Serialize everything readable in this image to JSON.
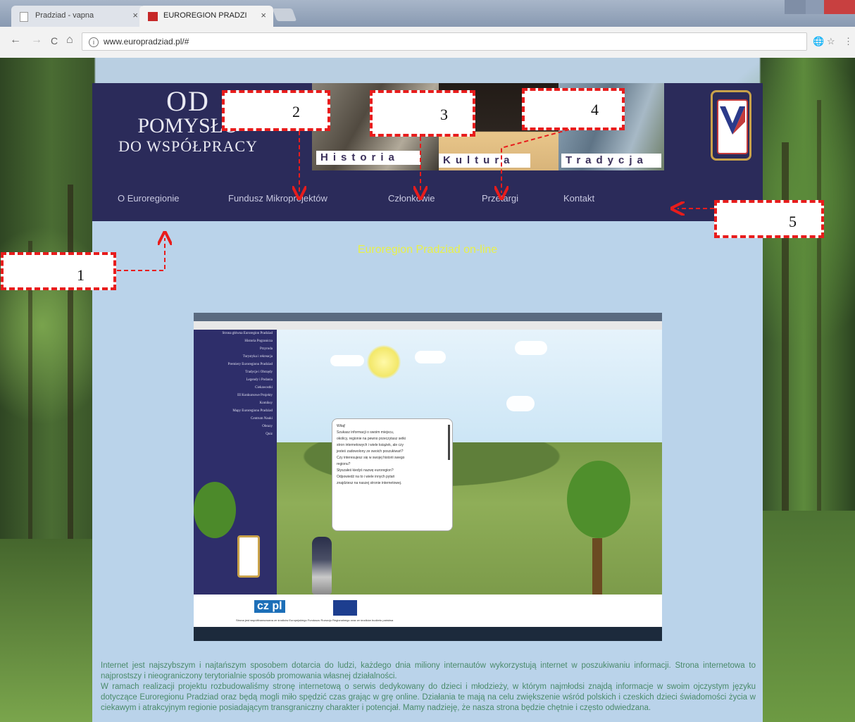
{
  "browser": {
    "tabs": [
      {
        "title": "Pradziad - vapna",
        "close": "×"
      },
      {
        "title": "EUROREGION PRADZI",
        "close": "×"
      }
    ],
    "url": "www.europradziad.pl/#",
    "info_icon": "i",
    "back_icon": "←",
    "forward_icon": "→",
    "reload_icon": "C",
    "home_icon": "⌂",
    "translate_icon": "🌐",
    "star_icon": "☆",
    "menu_icon": "⋮",
    "accent": "#e81c1c"
  },
  "site": {
    "logo": {
      "line1": "OD",
      "line2": "POMYSŁU",
      "line3": "DO WSPÓŁPRACY"
    },
    "banners": [
      "Historia",
      "Kultura",
      "Tradycja"
    ],
    "nav": [
      "O Euroregionie",
      "Fundusz Mikroprojektów",
      "Członkowie",
      "Przetargi",
      "Kontakt"
    ],
    "subtitle": "Euroregion Pradziad on-line",
    "screenshot": {
      "sidebar_items": [
        "Strona główna Euroregion Pradziad",
        "Historia Pogranicza",
        "Przyroda",
        "Turystyka i rekreacja",
        "Premiery Euroregionu Pradziad",
        "Tradycje i Obrzędy",
        "Legendy i Podania",
        "Ciekawostki",
        "III Konkursowe Projekty",
        "Komiksy",
        "Mapy Euroregionu Pradziad",
        "Centrum Nauki",
        "Obrazy",
        "Quiz"
      ],
      "bubble_text": [
        "Witaj!",
        "Szukasz informacji o swoim miejscu,",
        "okolicy, regionie na pewno przeczytasz setki",
        "stron internetowych i wiele książek, ale czy",
        "jesteś zadowolony ze swoich poszukiwań?",
        "Czy interesujesz się w swojej historii swego",
        "regionu?",
        "Słyszałeś kiedyś nazwę euroregion?",
        "Odpowiedź na to i wiele innych pytań",
        "znajdziesz na naszej stronie internetowej."
      ],
      "footer_logo": "cz pl",
      "footer_text": "Strona jest współfinansowana ze środków Europejskiego Funduszu Rozwoju Regionalnego oraz ze środków budżetu państwa"
    },
    "body_paragraphs": [
      "Internet jest najszybszym i najtańszym sposobem dotarcia do ludzi, każdego dnia miliony internautów wykorzystują internet w poszukiwaniu informacji. Strona internetowa to najprostszy i nieograniczony terytorialnie sposób promowania własnej działalności.",
      "W ramach realizacji projektu rozbudowaliśmy stronę internetową o serwis dedykowany do dzieci i młodzieży, w którym najmłodsi znajdą informacje w swoim ojczystym języku dotyczące Euroregionu Pradziad oraz będą mogli miło spędzić czas grając w grę online. Działania te mają na celu zwiększenie wśród polskich i czeskich dzieci świadomości życia w ciekawym i atrakcyjnym regionie posiadającym transgraniczny charakter i potencjał. Mamy nadzieję, że nasza strona będzie chętnie i często odwiedzana."
    ]
  },
  "annotations": [
    {
      "id": "1",
      "label": "1"
    },
    {
      "id": "2",
      "label": "2"
    },
    {
      "id": "3",
      "label": "3"
    },
    {
      "id": "4",
      "label": "4"
    },
    {
      "id": "5",
      "label": "5"
    }
  ]
}
